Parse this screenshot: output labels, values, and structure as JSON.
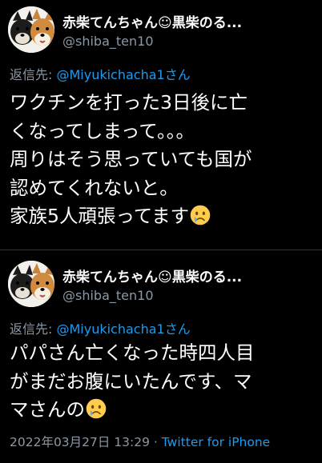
{
  "colors": {
    "background": "#000000",
    "text": "#ffffff",
    "muted": "#8b98a5",
    "link": "#1d9bf0",
    "divider": "#2f3336"
  },
  "tweets": [
    {
      "display_name": "赤柴てんちゃん☺黒柴のる...",
      "handle": "@shiba_ten10",
      "reply_prefix": "返信先: ",
      "reply_mention": "@Miyukichacha1さん",
      "lines": [
        "ワクチンを打った3日後に亡",
        "くなってしまって。。。",
        "周りはそう思っていても国が",
        "認めてくれないと。",
        "家族5人頑張ってます"
      ],
      "emoji": "crying-face"
    },
    {
      "display_name": "赤柴てんちゃん☺黒柴のる...",
      "handle": "@shiba_ten10",
      "reply_prefix": "返信先: ",
      "reply_mention": "@Miyukichacha1さん",
      "lines": [
        "パパさん亡くなった時四人目",
        "がまだお腹にいたんです、マ",
        "マさんの"
      ],
      "emoji": "crying-face",
      "timestamp": "2022年03月27日 13:29",
      "separator": " · ",
      "source": "Twitter for iPhone"
    }
  ]
}
